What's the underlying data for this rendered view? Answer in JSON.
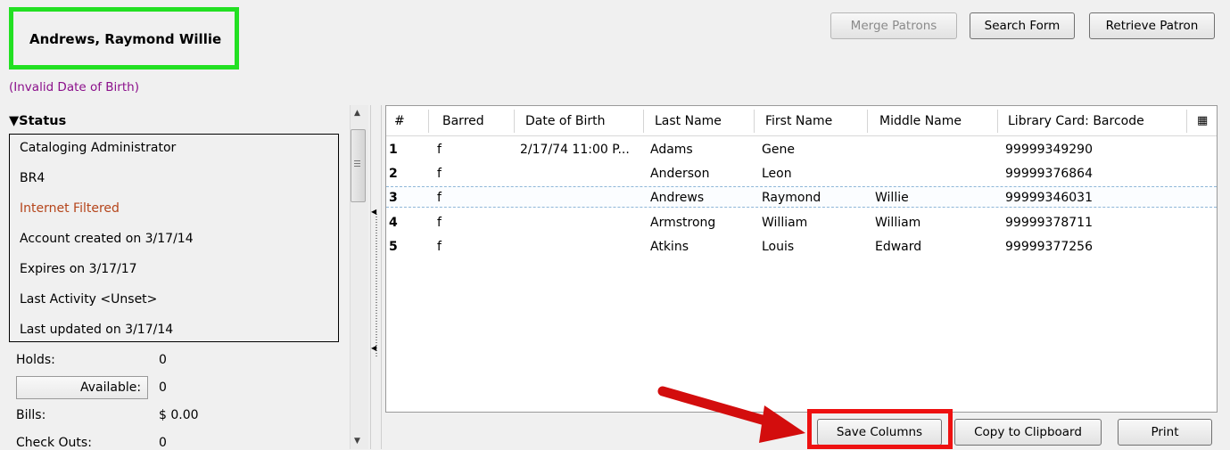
{
  "header": {
    "patron_name": "Andrews, Raymond Willie",
    "dob_warning": "(Invalid Date of Birth)",
    "buttons": {
      "merge": "Merge Patrons",
      "search_form": "Search Form",
      "retrieve": "Retrieve Patron"
    }
  },
  "status": {
    "title": "Status",
    "lines": [
      "Cataloging Administrator",
      "BR4",
      "Internet Filtered",
      "Account created on 3/17/14",
      "Expires on 3/17/17",
      "Last Activity <Unset>",
      "Last updated on 3/17/14"
    ],
    "holds_label": "Holds:",
    "holds_value": "0",
    "available_label": "Available:",
    "available_value": "0",
    "bills_label": "Bills:",
    "bills_value": "$ 0.00",
    "checkouts_label": "Check Outs:",
    "checkouts_value": "0"
  },
  "grid": {
    "columns": [
      "#",
      "Barred",
      "Date of Birth",
      "Last Name",
      "First Name",
      "Middle Name",
      "Library Card: Barcode"
    ],
    "rows": [
      {
        "num": "1",
        "barred": "f",
        "dob": "2/17/74 11:00 P...",
        "last": "Adams",
        "first": "Gene",
        "middle": "",
        "barcode": "99999349290"
      },
      {
        "num": "2",
        "barred": "f",
        "dob": "",
        "last": "Anderson",
        "first": "Leon",
        "middle": "",
        "barcode": "99999376864"
      },
      {
        "num": "3",
        "barred": "f",
        "dob": "",
        "last": "Andrews",
        "first": "Raymond",
        "middle": "Willie",
        "barcode": "99999346031"
      },
      {
        "num": "4",
        "barred": "f",
        "dob": "",
        "last": "Armstrong",
        "first": "William",
        "middle": "William",
        "barcode": "99999378711"
      },
      {
        "num": "5",
        "barred": "f",
        "dob": "",
        "last": "Atkins",
        "first": "Louis",
        "middle": "Edward",
        "barcode": "99999377256"
      }
    ],
    "selected_row": "3"
  },
  "footer_buttons": {
    "save_columns": "Save Columns",
    "copy": "Copy to Clipboard",
    "print": "Print"
  },
  "colors": {
    "highlight_green": "#22e022",
    "highlight_red": "#e11111",
    "warning_purple": "#8b108b",
    "filtered_orange": "#b5451b"
  }
}
